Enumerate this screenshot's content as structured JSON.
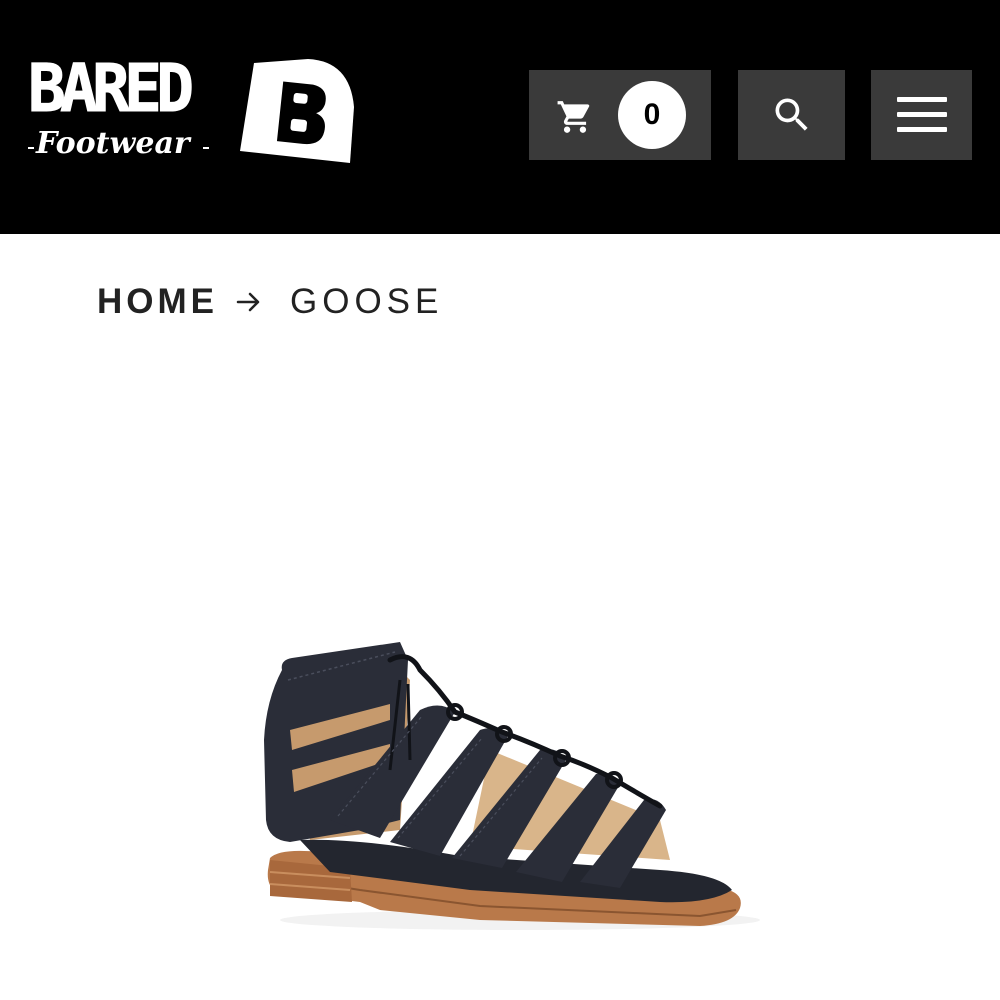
{
  "brand": {
    "name": "BARED",
    "tagline": "Footwear",
    "badge_letter": "B"
  },
  "header": {
    "cart_count": "0",
    "cart_icon": "cart-icon",
    "search_icon": "search-icon",
    "menu_icon": "hamburger-menu-icon"
  },
  "breadcrumb": {
    "home_label": "HOME",
    "separator_icon": "arrow-right-icon",
    "current_label": "GOOSE"
  },
  "product": {
    "image_alt": "Goose gladiator sandal",
    "image_subject": "black suede gladiator sandal with tan sole"
  },
  "colors": {
    "header_bg": "#000000",
    "button_bg": "#3a3a3a",
    "page_bg": "#ffffff",
    "text": "#222222"
  }
}
